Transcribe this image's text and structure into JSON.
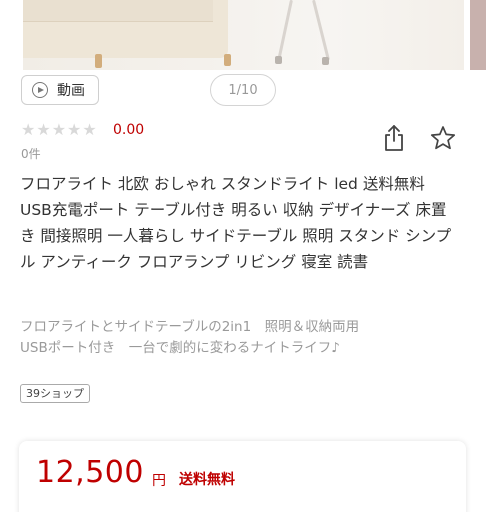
{
  "media": {
    "video_label": "動画",
    "pager": "1/10"
  },
  "rating": {
    "value": "0.00",
    "stars_filled": 0,
    "stars_total": 5,
    "review_count": "0件"
  },
  "product": {
    "title": "フロアライト 北欧 おしゃれ スタンドライト led 送料無料 USB充電ポート テーブル付き 明るい 収納 デザイナーズ 床置き 間接照明 一人暮らし サイドテーブル 照明 スタンド シンプル アンティーク フロアランプ リビング 寝室 読書",
    "catch_line1": "フロアライトとサイドテーブルの2in1　照明＆収納両用",
    "catch_line2": "USBポート付き　一台で劇的に変わるナイトライフ♪",
    "shop_tag": "39ショップ"
  },
  "price": {
    "amount": "12,500",
    "unit": "円",
    "shipping": "送料無料"
  },
  "icons": {
    "share": "share-icon",
    "favorite": "star-outline-icon",
    "play": "play-circle-icon"
  },
  "colors": {
    "price": "#bf0000",
    "star_empty": "#d9d9d9",
    "muted_text": "#999999"
  }
}
